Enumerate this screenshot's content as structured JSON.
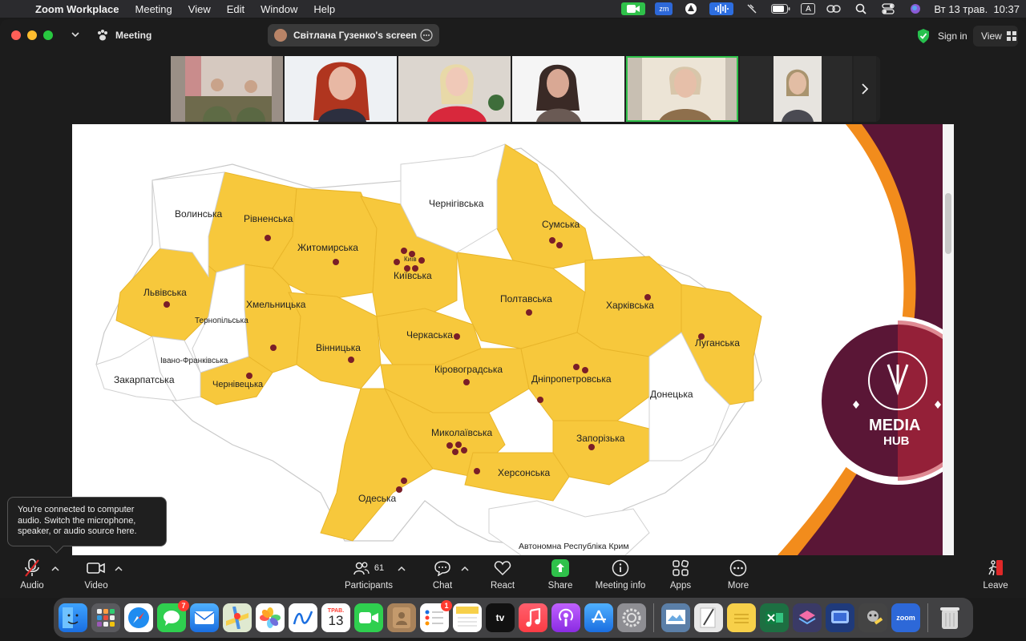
{
  "menubar": {
    "app_name": "Zoom Workplace",
    "items": [
      "Meeting",
      "View",
      "Edit",
      "Window",
      "Help"
    ],
    "clock": "Вт 13 трав.  10:37",
    "input_source": "A"
  },
  "titlebar": {
    "meeting_label": "Meeting",
    "share_label": "Світлана Гузенко's screen",
    "sign_in": "Sign in",
    "view": "View"
  },
  "map": {
    "regions": {
      "volynska": "Волинська",
      "rivnenska": "Рівненська",
      "zhytomyrska": "Житомирська",
      "kyivska": "Київська",
      "kyiv": "Київ",
      "chernihivska": "Чернігівська",
      "sumska": "Сумська",
      "lvivska": "Львівська",
      "ternopilska": "Тернопільська",
      "khmelnytska": "Хмельницька",
      "poltavska": "Полтавська",
      "kharkivska": "Харківська",
      "cherkaska": "Черкаська",
      "ivano_frankivska": "Івано-Франківська",
      "vinnytska": "Вінницька",
      "luhanska": "Луганська",
      "zakarpatska": "Закарпатська",
      "chernivetska": "Чернівецька",
      "kirovohradska": "Кіровоградська",
      "dnipropetrovska": "Дніпропетровська",
      "donetska": "Донецька",
      "mykolaivska": "Миколаївська",
      "zaporizka": "Запорізька",
      "khersonska": "Херсонська",
      "odeska": "Одеська",
      "crimea": "Автономна Республіка Крим"
    },
    "colors": {
      "highlight": "#f7c83c",
      "plain": "#ffffff",
      "dot": "#7a1e28",
      "border": "#c9c9c9"
    }
  },
  "logo": {
    "line1": "MEDIA",
    "line2": "HUB"
  },
  "tooltip": {
    "text": "You're connected to computer audio. Switch the microphone, speaker, or audio source here."
  },
  "toolbar": {
    "audio": "Audio",
    "video": "Video",
    "participants": "Participants",
    "participants_count": "61",
    "chat": "Chat",
    "react": "React",
    "share": "Share",
    "meeting_info": "Meeting info",
    "apps": "Apps",
    "more": "More",
    "leave": "Leave"
  },
  "dock": {
    "messages_badge": "7",
    "reminders_badge": "1",
    "calendar_month": "ТРАВ.",
    "calendar_day": "13",
    "appletv": "tv",
    "zoom": "zoom"
  }
}
